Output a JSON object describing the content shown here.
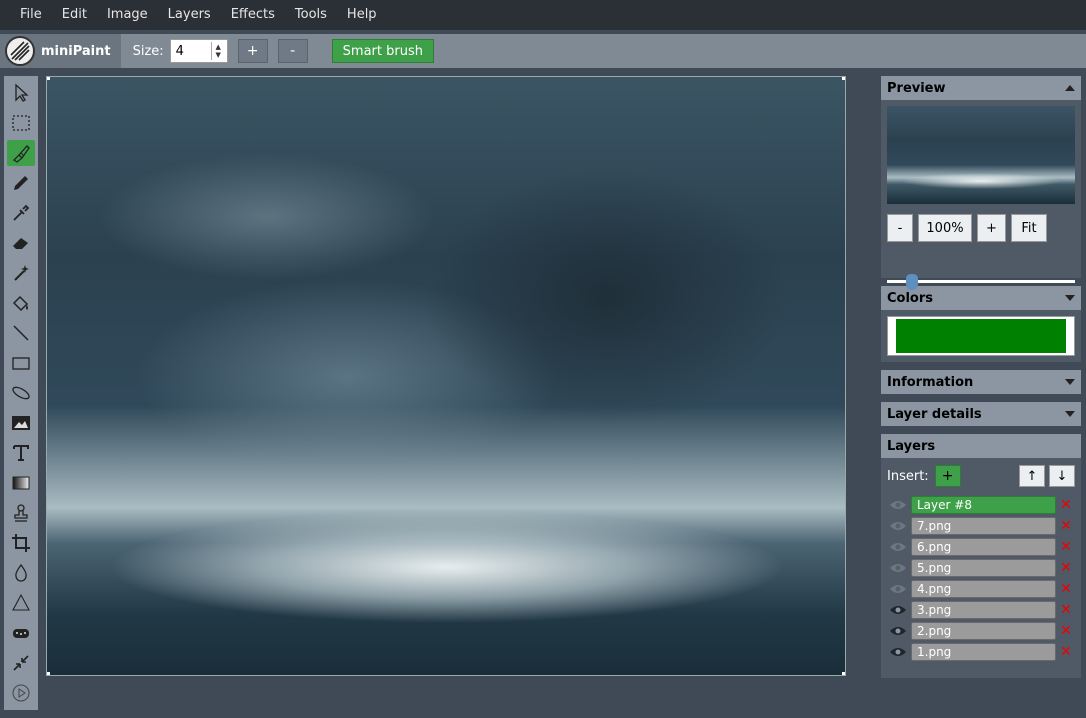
{
  "menu": [
    "File",
    "Edit",
    "Image",
    "Layers",
    "Effects",
    "Tools",
    "Help"
  ],
  "toolbar": {
    "app_name": "miniPaint",
    "size_label": "Size:",
    "size_value": "4",
    "plus_label": "+",
    "minus_label": "-",
    "smart_brush_label": "Smart brush"
  },
  "tools": [
    {
      "name": "select-icon",
      "active": false
    },
    {
      "name": "selection-icon",
      "active": false
    },
    {
      "name": "brush-icon",
      "active": true
    },
    {
      "name": "pencil-icon",
      "active": false
    },
    {
      "name": "pick-color-icon",
      "active": false
    },
    {
      "name": "erase-icon",
      "active": false
    },
    {
      "name": "magic-wand-icon",
      "active": false
    },
    {
      "name": "fill-icon",
      "active": false
    },
    {
      "name": "line-icon",
      "active": false
    },
    {
      "name": "rectangle-icon",
      "active": false
    },
    {
      "name": "ellipse-icon",
      "active": false
    },
    {
      "name": "image-icon",
      "active": false
    },
    {
      "name": "text-icon",
      "active": false
    },
    {
      "name": "gradient-icon",
      "active": false
    },
    {
      "name": "clone-icon",
      "active": false
    },
    {
      "name": "crop-icon",
      "active": false
    },
    {
      "name": "blur-icon",
      "active": false
    },
    {
      "name": "sharpen-icon",
      "active": false
    },
    {
      "name": "desaturate-icon",
      "active": false
    },
    {
      "name": "bulge-pinch-icon",
      "active": false
    },
    {
      "name": "animation-icon",
      "active": false
    }
  ],
  "preview": {
    "title": "Preview",
    "zoom_minus": "-",
    "zoom_value": "100%",
    "zoom_plus": "+",
    "zoom_fit": "Fit",
    "zoom_slider_fraction": 0.05
  },
  "colors": {
    "title": "Colors",
    "current_color": "#008000"
  },
  "information": {
    "title": "Information"
  },
  "layer_details": {
    "title": "Layer details"
  },
  "layers": {
    "title": "Layers",
    "insert_label": "Insert:",
    "insert_button": "+",
    "up_button": "↑",
    "down_button": "↓",
    "items": [
      {
        "name": "Layer #8",
        "visible": false,
        "active": true
      },
      {
        "name": "7.png",
        "visible": false,
        "active": false
      },
      {
        "name": "6.png",
        "visible": false,
        "active": false
      },
      {
        "name": "5.png",
        "visible": false,
        "active": false
      },
      {
        "name": "4.png",
        "visible": false,
        "active": false
      },
      {
        "name": "3.png",
        "visible": true,
        "active": false
      },
      {
        "name": "2.png",
        "visible": true,
        "active": false
      },
      {
        "name": "1.png",
        "visible": true,
        "active": false
      }
    ],
    "delete_symbol": "✕"
  },
  "accent_color": "#3fa04a"
}
